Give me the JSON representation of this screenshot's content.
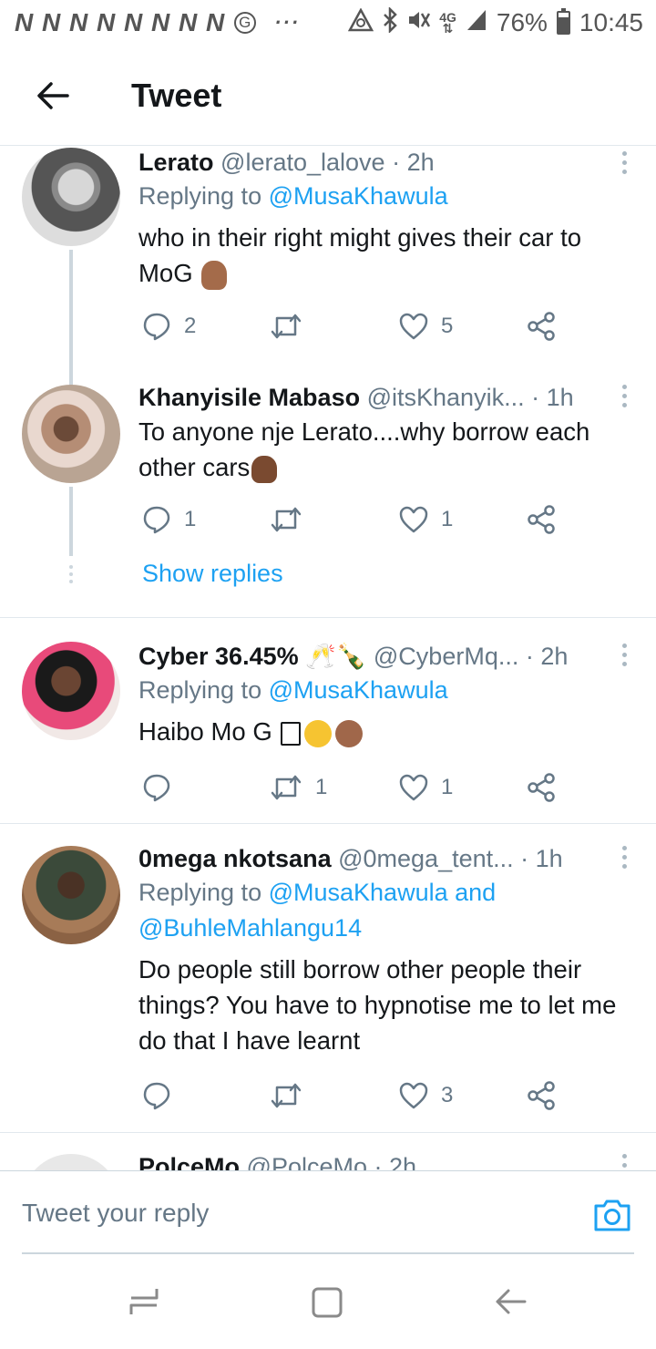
{
  "status_bar": {
    "notifications": "N N N N N N N N",
    "g_icon": "G",
    "dots": "···",
    "network": "4G",
    "battery": "76%",
    "battery_level": 0.76,
    "time": "10:45"
  },
  "header": {
    "title": "Tweet"
  },
  "tweets": [
    {
      "name": "Lerato",
      "handle": "@lerato_lalove",
      "time": "· 2h",
      "replying_prefix": "Replying to ",
      "replying_to": "@MusaKhawula",
      "text": "who in their right might gives their car to MoG",
      "emoji": "facepalm-emoji",
      "replies": "2",
      "retweets": "",
      "likes": "5"
    },
    {
      "name": "Khanyisile Mabaso",
      "handle": "@itsKhanyik...",
      "time": "· 1h",
      "text": "To anyone nje Lerato....why borrow each other cars",
      "emoji": "shrug-emoji",
      "replies": "1",
      "retweets": "",
      "likes": "1"
    },
    {
      "name": "Cyber 36.45%",
      "handle": "@CyberMq...",
      "time": "· 2h",
      "replying_prefix": "Replying to ",
      "replying_to": "@MusaKhawula",
      "text": "Haibo Mo G",
      "replies": "",
      "retweets": "1",
      "likes": "1"
    },
    {
      "name": "0mega nkotsana",
      "handle": "@0mega_tent...",
      "time": "· 1h",
      "replying_prefix": "Replying to ",
      "replying_to": "@MusaKhawula and @BuhleMahlangu14",
      "text": "Do people still borrow other people their things? You have to hypnotise me to let me do that I have learnt",
      "replies": "",
      "retweets": "",
      "likes": "3"
    },
    {
      "name": "PolceMo",
      "handle": "@PolceMo",
      "time": "· 2h"
    }
  ],
  "show_replies": "Show replies",
  "reply_bar": {
    "placeholder": "Tweet your reply"
  },
  "colors": {
    "accent": "#1da1f2",
    "muted": "#657786",
    "text": "#14171a",
    "line": "#ccd6dd"
  }
}
